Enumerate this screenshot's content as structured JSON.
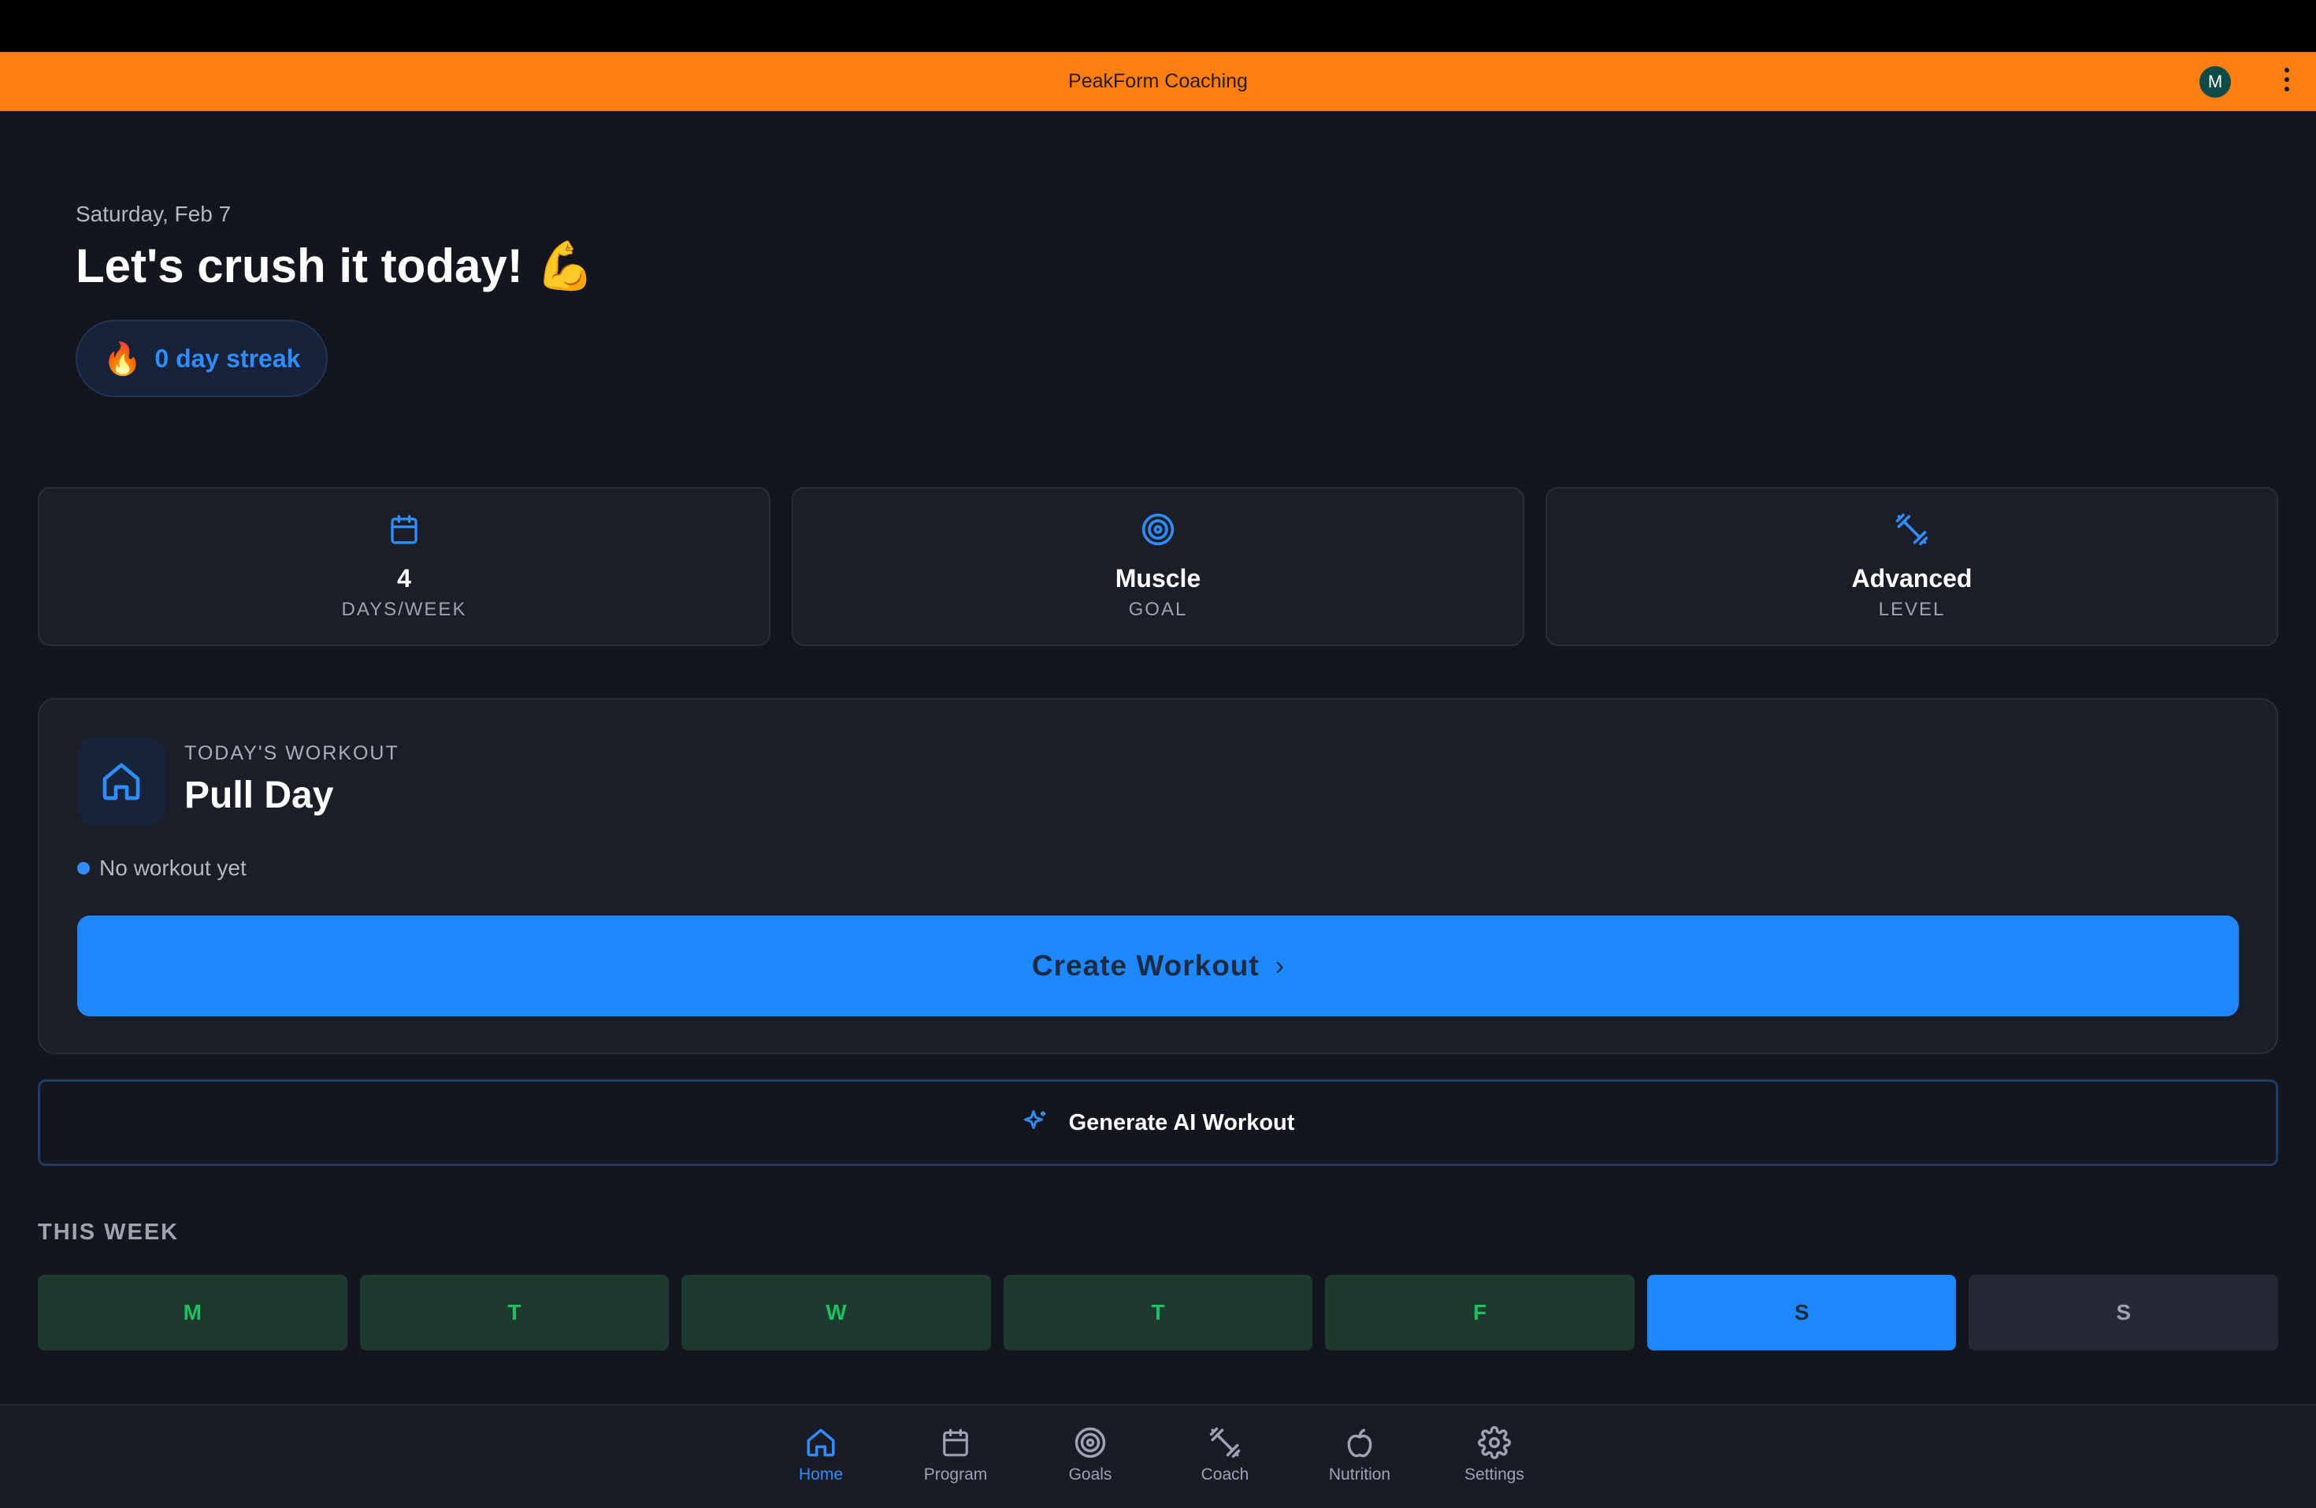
{
  "app": {
    "title": "PeakForm Coaching",
    "avatar_initial": "M"
  },
  "greeting": {
    "date": "Saturday, Feb 7",
    "headline": "Let's crush it today! 💪",
    "streak_icon": "🔥",
    "streak": "0 day streak"
  },
  "stats": [
    {
      "icon": "calendar-icon",
      "value": "4",
      "label": "DAYS/WEEK"
    },
    {
      "icon": "target-icon",
      "value": "Muscle",
      "label": "GOAL"
    },
    {
      "icon": "dumbbell-icon",
      "value": "Advanced",
      "label": "LEVEL"
    }
  ],
  "workout": {
    "eyebrow": "TODAY'S WORKOUT",
    "title": "Pull Day",
    "status": "No workout yet",
    "create_label": "Create Workout",
    "create_chevron": "›"
  },
  "ai": {
    "label": "Generate AI Workout"
  },
  "week": {
    "title": "THIS WEEK",
    "days": [
      {
        "letter": "M",
        "state": "done"
      },
      {
        "letter": "T",
        "state": "done"
      },
      {
        "letter": "W",
        "state": "done"
      },
      {
        "letter": "T",
        "state": "done"
      },
      {
        "letter": "F",
        "state": "done"
      },
      {
        "letter": "S",
        "state": "today"
      },
      {
        "letter": "S",
        "state": "future"
      }
    ]
  },
  "nav": {
    "active": "Home",
    "items": [
      {
        "label": "Home",
        "icon": "home-icon"
      },
      {
        "label": "Program",
        "icon": "calendar-icon"
      },
      {
        "label": "Goals",
        "icon": "target-icon"
      },
      {
        "label": "Coach",
        "icon": "dumbbell-icon"
      },
      {
        "label": "Nutrition",
        "icon": "apple-icon"
      },
      {
        "label": "Settings",
        "icon": "gear-icon"
      }
    ]
  },
  "colors": {
    "accent": "#1d88ff",
    "appbar": "#ff7f14",
    "background": "#13151f",
    "card": "#1b1e29",
    "done_day": "#1c3a2d",
    "done_text": "#1fbf62"
  }
}
